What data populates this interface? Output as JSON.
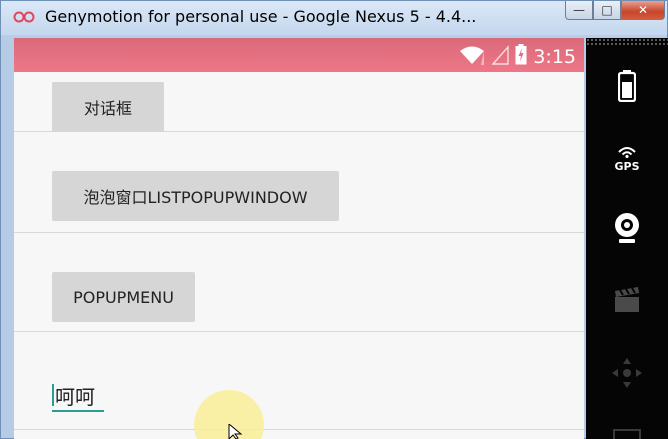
{
  "window": {
    "title": "Genymotion for personal use - Google Nexus 5 - 4.4...",
    "minimize_label": "—",
    "maximize_label": "□",
    "close_label": "✕"
  },
  "statusbar": {
    "time": "3:15",
    "accent": "#ee7787"
  },
  "content": {
    "buttons": [
      {
        "label": "对话框"
      },
      {
        "label": "泡泡窗口LISTPOPUPWINDOW"
      },
      {
        "label": "POPUPMENU"
      }
    ],
    "edit_text": {
      "value": "呵呵"
    }
  },
  "sidepanel": {
    "gps_label": "GPS",
    "icons": [
      "battery-icon",
      "gps-icon",
      "webcam-icon",
      "clapperboard-icon",
      "dpad-icon"
    ]
  }
}
